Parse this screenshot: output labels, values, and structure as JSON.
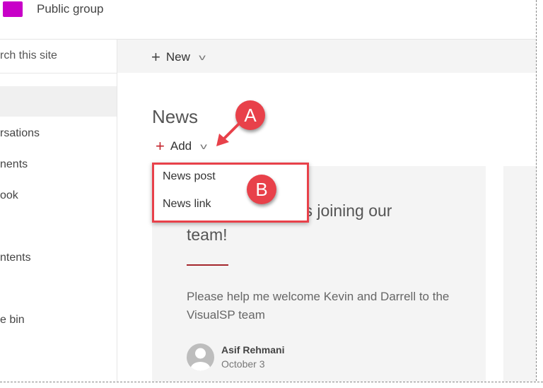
{
  "header": {
    "group_label": "Public group",
    "logo_color": "#c800c8"
  },
  "search": {
    "placeholder": "rch this site"
  },
  "command_bar": {
    "new_label": "New"
  },
  "sidebar": {
    "items": [
      {
        "label": "rsations"
      },
      {
        "label": "nents"
      },
      {
        "label": "ook"
      },
      {
        "label": "ntents"
      },
      {
        "label": "e bin"
      }
    ]
  },
  "news": {
    "title": "News",
    "add_label": "Add",
    "menu": [
      {
        "label": "News post"
      },
      {
        "label": "News link"
      }
    ],
    "card": {
      "title_line1": "ers joining our",
      "title_line2": "team!",
      "description": "Please help me welcome Kevin and Darrell to the VisualSP team",
      "author": "Asif Rehmani",
      "date": "October 3"
    }
  },
  "annotations": {
    "a": "A",
    "b": "B",
    "color": "#e8414a"
  }
}
